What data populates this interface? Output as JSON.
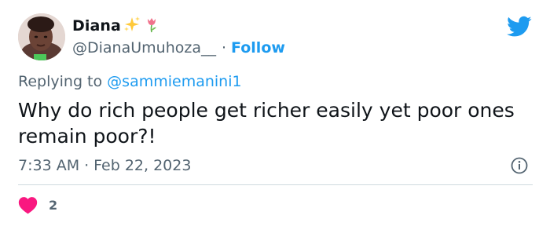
{
  "author": {
    "display_name": "Diana",
    "name_emojis": [
      "sparkles-emoji",
      "tulip-emoji"
    ],
    "handle": "@DianaUmuhoza__",
    "separator": "·",
    "follow_label": "Follow"
  },
  "reply": {
    "prefix": "Replying to",
    "mention": "@sammiemanini1"
  },
  "tweet": {
    "text": "Why do rich people get richer easily yet poor ones remain poor?!",
    "time": "7:33 AM",
    "separator": "·",
    "date": "Feb 22, 2023"
  },
  "engagement": {
    "likes": "2"
  },
  "icons": {
    "brand": "twitter-bird-icon",
    "info": "info-icon",
    "like": "heart-icon"
  },
  "colors": {
    "brand_blue": "#1d9bf0",
    "heart_pink": "#f91880",
    "text_primary": "#0f1419",
    "text_secondary": "#536471",
    "divider": "#cfd9de"
  }
}
